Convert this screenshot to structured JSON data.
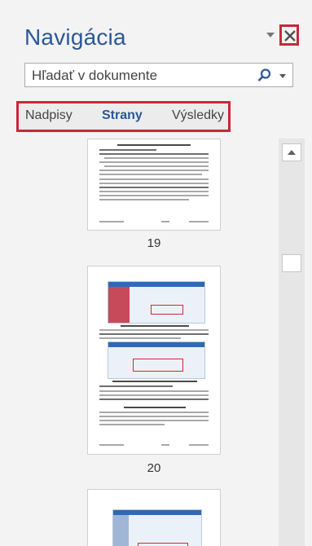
{
  "pane": {
    "title": "Navigácia",
    "menu_icon": "chevron-down-icon",
    "close_icon": "close-icon"
  },
  "search": {
    "placeholder": "Hľadať v dokumente",
    "icon": "search-icon"
  },
  "tabs": [
    {
      "label": "Nadpisy",
      "active": false
    },
    {
      "label": "Strany",
      "active": true
    },
    {
      "label": "Výsledky",
      "active": false
    }
  ],
  "pages": [
    {
      "number": "19"
    },
    {
      "number": "20"
    },
    {
      "number": ""
    }
  ],
  "colors": {
    "accent": "#2b579a",
    "highlight_border": "#c8283a",
    "background": "#f3f3f3"
  }
}
